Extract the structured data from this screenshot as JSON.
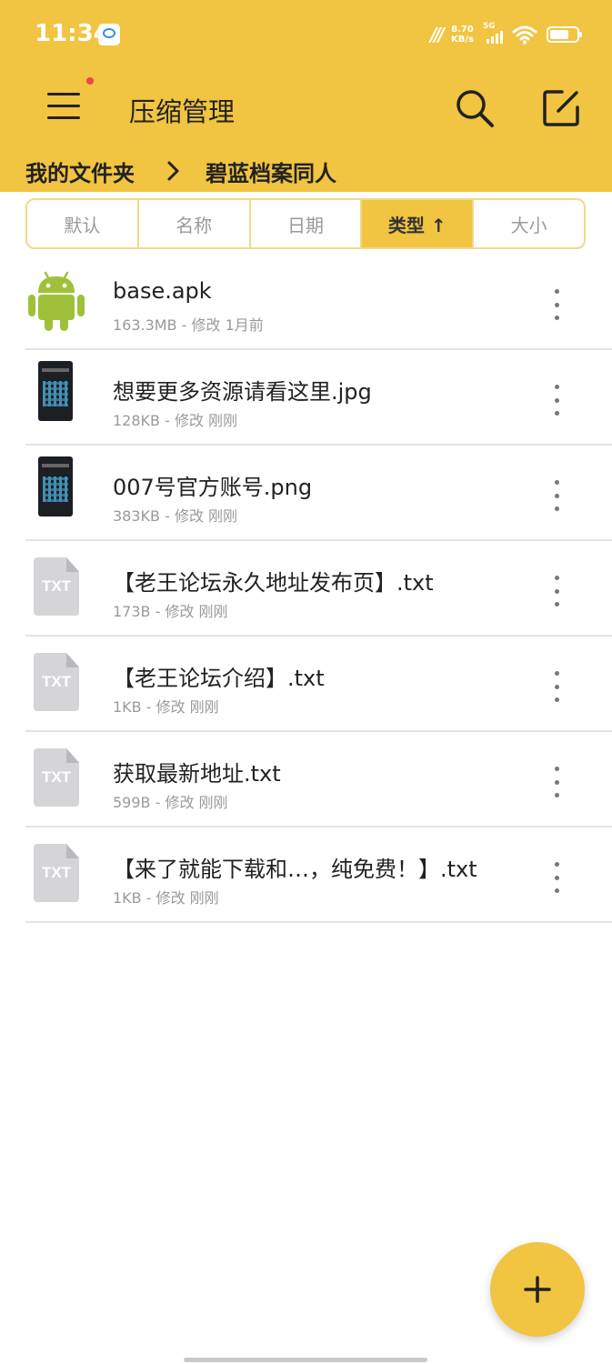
{
  "status_bar": {
    "time": "11:34",
    "speed_value": "8.70",
    "speed_unit": "KB/s",
    "network": "5G",
    "battery_level": 0.7
  },
  "header": {
    "title": "压缩管理",
    "has_notification": true
  },
  "breadcrumb": {
    "items": [
      "我的文件夹",
      "碧蓝档案同人"
    ]
  },
  "sort_tabs": [
    {
      "label": "默认",
      "active": false
    },
    {
      "label": "名称",
      "active": false
    },
    {
      "label": "日期",
      "active": false
    },
    {
      "label": "类型 ↑",
      "active": true
    },
    {
      "label": "大小",
      "active": false
    }
  ],
  "files": [
    {
      "name": "base.apk",
      "meta": "163.3MB - 修改 1月前",
      "icon": "android-icon"
    },
    {
      "name": "想要更多资源请看这里.jpg",
      "meta": "128KB - 修改 刚刚",
      "icon": "image-thumbnail"
    },
    {
      "name": "007号官方账号.png",
      "meta": "383KB - 修改 刚刚",
      "icon": "image-thumbnail"
    },
    {
      "name": "【老王论坛永久地址发布页】.txt",
      "meta": "173B - 修改 刚刚",
      "icon": "txt-file-icon"
    },
    {
      "name": "【老王论坛介绍】.txt",
      "meta": "1KB - 修改 刚刚",
      "icon": "txt-file-icon"
    },
    {
      "name": "获取最新地址.txt",
      "meta": "599B - 修改 刚刚",
      "icon": "txt-file-icon"
    },
    {
      "name": "【来了就能下载和…，纯免费！】.txt",
      "meta": "1KB - 修改 刚刚",
      "icon": "txt-file-icon"
    }
  ],
  "txt_icon_label": "TXT",
  "colors": {
    "accent": "#F1C441",
    "accent_border": "#F1D98A",
    "notification_dot": "#e94b3c",
    "android_green": "#9FC139"
  }
}
